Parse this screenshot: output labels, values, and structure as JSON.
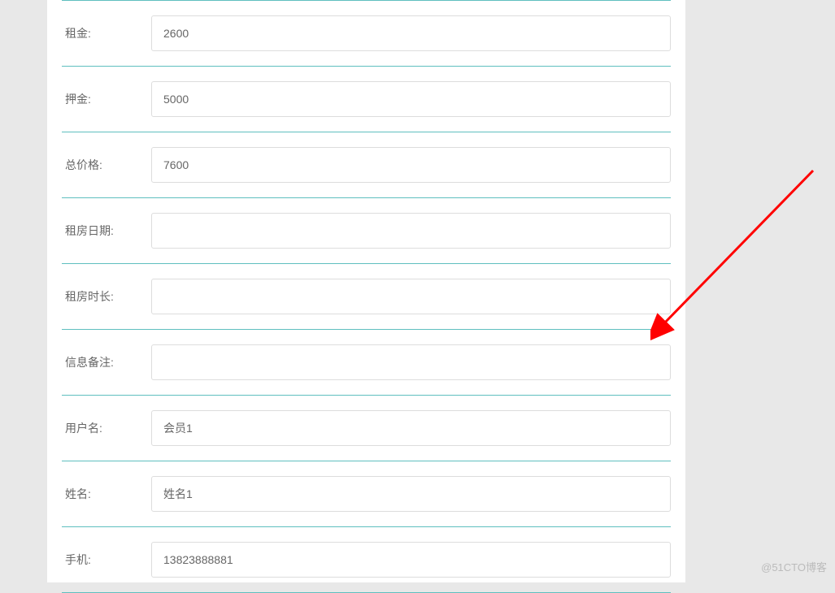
{
  "form": {
    "fields": [
      {
        "label": "租金:",
        "value": "2600",
        "name": "rent"
      },
      {
        "label": "押金:",
        "value": "5000",
        "name": "deposit"
      },
      {
        "label": "总价格:",
        "value": "7600",
        "name": "total-price"
      },
      {
        "label": "租房日期:",
        "value": "",
        "name": "rental-date"
      },
      {
        "label": "租房时长:",
        "value": "",
        "name": "rental-duration"
      },
      {
        "label": "信息备注:",
        "value": "",
        "name": "info-remarks"
      },
      {
        "label": "用户名:",
        "value": "会员1",
        "name": "username"
      },
      {
        "label": "姓名:",
        "value": "姓名1",
        "name": "full-name"
      },
      {
        "label": "手机:",
        "value": "13823888881",
        "name": "phone"
      }
    ]
  },
  "watermark": "@51CTO博客"
}
